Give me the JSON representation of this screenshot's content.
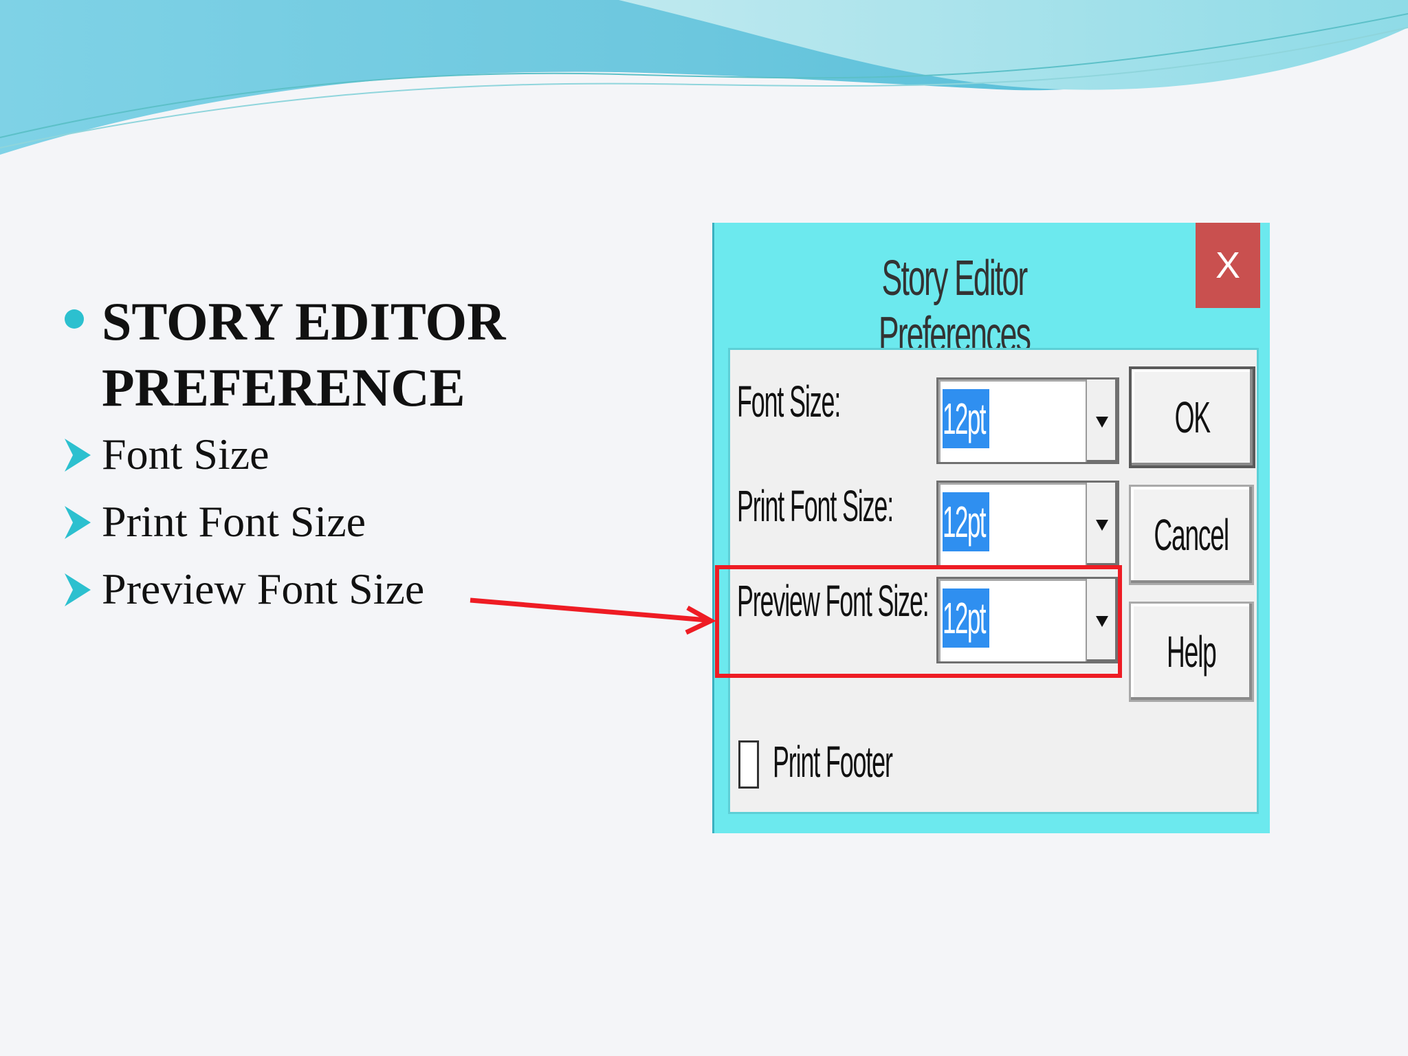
{
  "slide": {
    "heading": "STORY EDITOR PREFERENCE",
    "items": [
      "Font Size",
      "Print Font Size",
      "Preview Font Size"
    ]
  },
  "dialog": {
    "title": "Story Editor Preferences",
    "close_label": "X",
    "fields": [
      {
        "label": "Font Size:",
        "value": "12pt"
      },
      {
        "label": "Print Font Size:",
        "value": "12pt"
      },
      {
        "label": "Preview Font Size:",
        "value": "12pt"
      }
    ],
    "buttons": {
      "ok": "OK",
      "cancel": "Cancel",
      "help": "Help"
    },
    "checkbox": {
      "label": "Print Footer",
      "checked": false
    }
  },
  "colors": {
    "accent": "#2cc0cf",
    "dialog_bg": "#6ce9ee",
    "close_bg": "#c9504f",
    "highlight": "#ee1c24",
    "selection": "#2f8ff0"
  },
  "icons": {
    "main_bullet": "filled-circle-bullet",
    "sub_bullet": "arrowhead-bullet",
    "dropdown": "triangle-down-icon"
  }
}
